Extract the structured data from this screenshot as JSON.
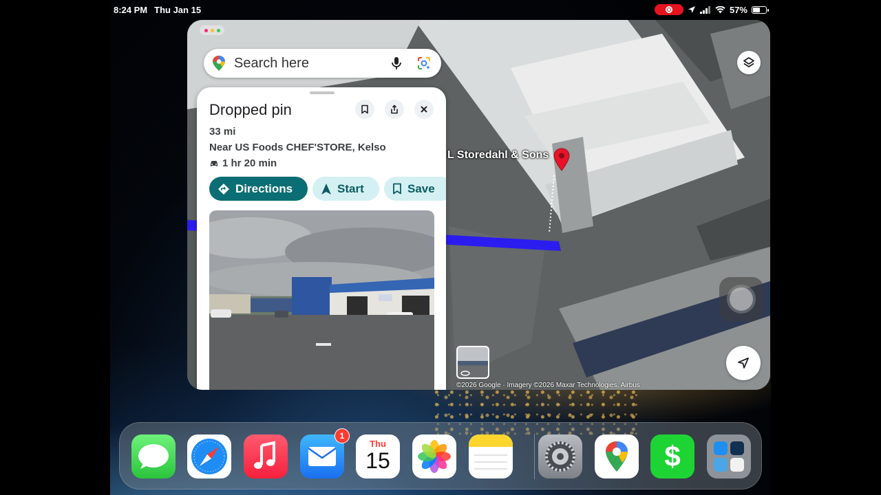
{
  "status_bar": {
    "time": "8:24 PM",
    "date": "Thu Jan 15",
    "battery": "57%",
    "battery_level": 0.57
  },
  "maps": {
    "search": {
      "placeholder": "Search here"
    },
    "place_label": "L Storedahl & Sons",
    "copyright": "©2026 Google · Imagery ©2026 Maxar Technologies, Airbus",
    "sheet": {
      "title": "Dropped pin",
      "distance": "33 mi",
      "near": "Near US Foods CHEF'STORE, Kelso",
      "drive_time": "1 hr 20 min",
      "actions": {
        "directions": "Directions",
        "start": "Start",
        "save": "Save"
      }
    },
    "colors": {
      "accent": "#0b6e74",
      "chip_bg": "#d4f0f2",
      "route": "#2b1cf0",
      "pin": "#e8132a"
    }
  },
  "dock": {
    "apps": [
      {
        "name": "Messages",
        "icon": "messages-icon"
      },
      {
        "name": "Safari",
        "icon": "safari-icon"
      },
      {
        "name": "Music",
        "icon": "music-icon"
      },
      {
        "name": "Mail",
        "icon": "mail-icon",
        "badge": "1"
      },
      {
        "name": "Calendar",
        "icon": "calendar-icon",
        "day_label": "Thu",
        "day_number": "15"
      },
      {
        "name": "Photos",
        "icon": "photos-icon"
      },
      {
        "name": "Notes",
        "icon": "notes-icon"
      },
      {
        "name": "Settings",
        "icon": "settings-icon"
      },
      {
        "name": "Google Maps",
        "icon": "google-maps-icon"
      },
      {
        "name": "Cash App",
        "icon": "cash-app-icon",
        "glyph": "$"
      },
      {
        "name": "App Library",
        "icon": "app-library-icon"
      }
    ]
  }
}
